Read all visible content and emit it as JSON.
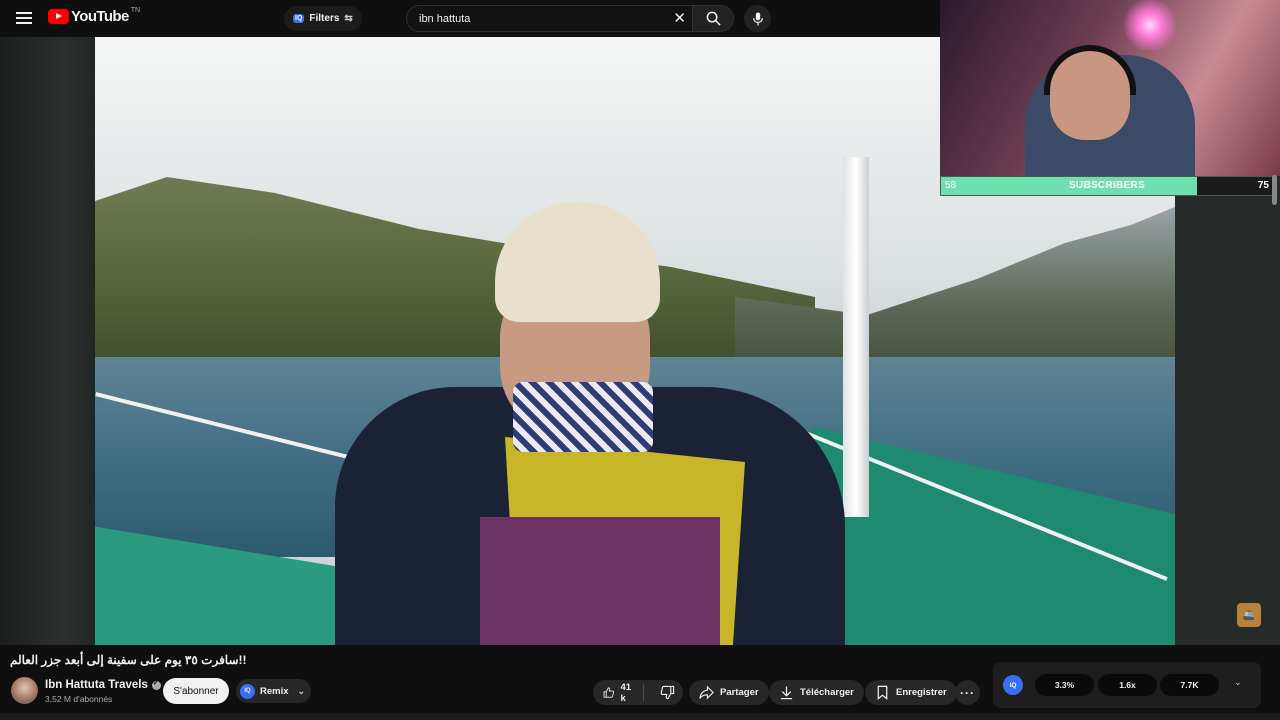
{
  "header": {
    "logo_text": "YouTube",
    "logo_sup": "TN",
    "filters_badge": "IQ",
    "filters_label": "Filters",
    "search_value": "ibn hattuta"
  },
  "overlay": {
    "subscribers_label": "SUBSCRIBERS",
    "subscribers_min": "58",
    "subscribers_max": "75",
    "subscribers_progress": 0.77
  },
  "video": {
    "title": "!!سافرت ٣٥ يوم على سفينة إلى أبعد جزر العالم"
  },
  "channel": {
    "name": "Ibn Hattuta Travels",
    "subscribers": "3,52 M d'abonnés",
    "subscribe_label": "S'abonner",
    "remix_badge": "IQ",
    "remix_label": "Remix"
  },
  "actions": {
    "like_count": "41 k",
    "share_label": "Partager",
    "download_label": "Télécharger",
    "save_label": "Enregistrer"
  },
  "stats": {
    "badge": "IQ",
    "values": [
      "3.3%",
      "1.6x",
      "7.7K"
    ]
  }
}
